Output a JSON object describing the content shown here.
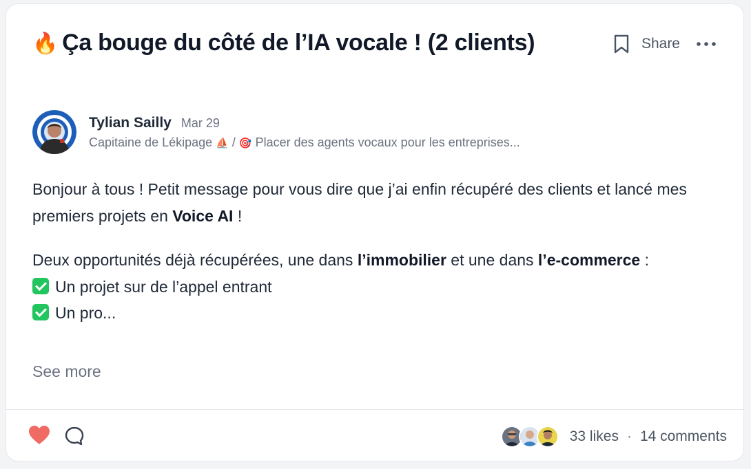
{
  "post": {
    "title_emoji": "🔥",
    "title": "Ça bouge du côté de l’IA vocale ! (2 clients)",
    "share_label": "Share",
    "author": {
      "name": "Tylian Sailly",
      "date": "Mar 29",
      "bio_part1": "Capitaine de Lékipage",
      "bio_emoji1": "⛵",
      "bio_sep": " / ",
      "bio_emoji2": "🎯",
      "bio_part2": "Placer des agents vocaux pour les entreprises..."
    },
    "body": {
      "p1_a": "Bonjour à tous ! Petit message pour vous dire que j’ai enfin récupéré des clients et lancé mes premiers projets en ",
      "p1_bold": "Voice AI",
      "p1_b": " !",
      "p2_a": "Deux opportunités déjà récupérées, une dans ",
      "p2_bold1": "l’immobilier",
      "p2_b": " et une dans ",
      "p2_bold2": "l’e-commerce",
      "p2_c": " :",
      "item1": "Un projet sur de l’appel entrant",
      "item2": "Un pro..."
    },
    "see_more": "See more",
    "likes": "33 likes",
    "separator": "·",
    "comments": "14 comments"
  },
  "icons": {
    "bookmark": "bookmark-icon",
    "more": "more-horizontal-icon",
    "like": "heart-icon",
    "comment": "comment-bubble-icon",
    "check": "check-mark-icon"
  },
  "colors": {
    "like": "#ef6b64",
    "check": "#22c55e",
    "text": "#1f2937",
    "muted": "#6b7280"
  }
}
